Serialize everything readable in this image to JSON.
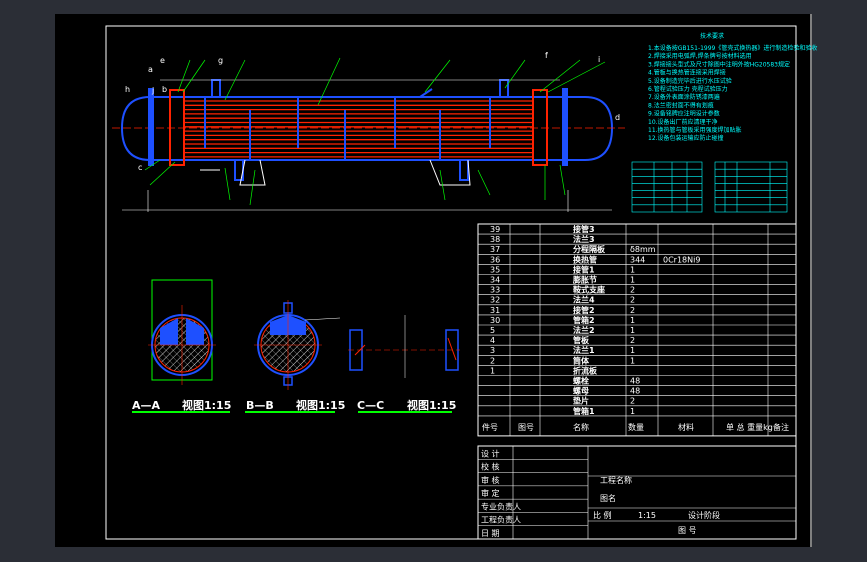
{
  "colors": {
    "background": "#2b2e36",
    "sheet": "#000000",
    "frame": "#ffffff",
    "shell": "#1e50ff",
    "tubes": "#ff2200",
    "leaders": "#00ff00",
    "notes": "#00ffff",
    "title_yellow": "#ffff00"
  },
  "notes": {
    "title": "技术要求",
    "lines": [
      "1.本设备按GB151-1999《管壳式换热器》进行制造检验和验收",
      "2.焊接采用电弧焊,焊条牌号按材料选用",
      "3.焊接接头型式及尺寸除图中注明外按HG20583规定",
      "4.管板与换热管连接采用焊接",
      "5.设备制造完毕后进行水压试验",
      "6.管程试验压力 壳程试验压力",
      "7.设备外表面涂防锈漆两遍",
      "8.法兰密封面不得有划痕",
      "9.设备铭牌应注明设计参数",
      "10.设备出厂前应清理干净",
      "11.换热管与管板采用强度焊加贴胀",
      "12.设备包装运输应防止碰撞"
    ]
  },
  "tables": {
    "design_rows": 7,
    "nozzle_rows": 7
  },
  "sections": [
    {
      "name": "A—A",
      "view": "视图1:15"
    },
    {
      "name": "B—B",
      "view": "视图1:15"
    },
    {
      "name": "C—C",
      "view": "视图1:15"
    }
  ],
  "leader_letters": [
    "a",
    "b",
    "c",
    "d",
    "e",
    "f",
    "g",
    "h",
    "i",
    "j"
  ],
  "bom": {
    "rows": [
      {
        "no": "39",
        "name": "接管3",
        "qty": "",
        "material": "",
        "remark": ""
      },
      {
        "no": "38",
        "name": "法兰3",
        "qty": "",
        "material": "",
        "remark": ""
      },
      {
        "no": "37",
        "name": "分程隔板",
        "qty": "δ8mm",
        "material": "",
        "remark": ""
      },
      {
        "no": "36",
        "name": "换热管",
        "qty": "344",
        "material": "0Cr18Ni9",
        "remark": ""
      },
      {
        "no": "35",
        "name": "接管1",
        "qty": "1",
        "material": "",
        "remark": ""
      },
      {
        "no": "34",
        "name": "膨胀节",
        "qty": "1",
        "material": "",
        "remark": ""
      },
      {
        "no": "33",
        "name": "鞍式支座",
        "qty": "2",
        "material": "",
        "remark": ""
      },
      {
        "no": "32",
        "name": "法兰4",
        "qty": "2",
        "material": "",
        "remark": ""
      },
      {
        "no": "31",
        "name": "接管2",
        "qty": "2",
        "material": "",
        "remark": ""
      },
      {
        "no": "30",
        "name": "管箱2",
        "qty": "1",
        "material": "",
        "remark": ""
      },
      {
        "no": "5",
        "name": "法兰2",
        "qty": "1",
        "material": "",
        "remark": ""
      },
      {
        "no": "4",
        "name": "管板",
        "qty": "2",
        "material": "",
        "remark": ""
      },
      {
        "no": "3",
        "name": "法兰1",
        "qty": "1",
        "material": "",
        "remark": ""
      },
      {
        "no": "2",
        "name": "筒体",
        "qty": "1",
        "material": "",
        "remark": ""
      },
      {
        "no": "1",
        "name": "折流板",
        "qty": "",
        "material": "",
        "remark": ""
      },
      {
        "no": "",
        "name": "螺栓",
        "qty": "48",
        "material": "",
        "remark": ""
      },
      {
        "no": "",
        "name": "螺母",
        "qty": "48",
        "material": "",
        "remark": ""
      },
      {
        "no": "",
        "name": "垫片",
        "qty": "2",
        "material": "",
        "remark": ""
      },
      {
        "no": "",
        "name": "管箱1",
        "qty": "1",
        "material": "",
        "remark": ""
      }
    ],
    "header": {
      "no": "件号",
      "code": "图号",
      "name": "名称",
      "qty": "数量",
      "material": "材料",
      "weight": "单 总\n重量kg",
      "remark": "备注"
    }
  },
  "title_block": {
    "left_labels": [
      "设 计",
      "校 核",
      "审 核",
      "审 定",
      "专业负责人",
      "工程负责人",
      "日 期"
    ],
    "project_label": "工程名称",
    "drawing_label": "图名",
    "scale_label": "比 例",
    "scale_value": "1:15",
    "stage_label": "设计阶段",
    "number_label": "图 号"
  }
}
